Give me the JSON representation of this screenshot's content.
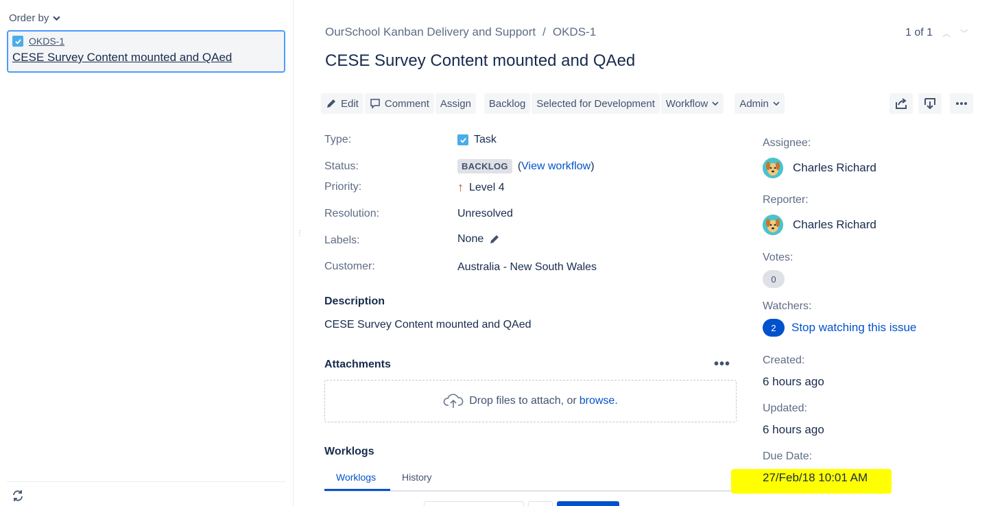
{
  "sidebar": {
    "order_by_label": "Order by",
    "issue": {
      "key": "OKDS-1",
      "summary": "CESE Survey Content mounted and QAed"
    }
  },
  "header": {
    "breadcrumb": {
      "project": "OurSchool Kanban Delivery and Support",
      "separator": "/",
      "key": "OKDS-1"
    },
    "pager": "1 of 1",
    "title": "CESE Survey Content mounted and QAed"
  },
  "toolbar": {
    "edit": "Edit",
    "comment": "Comment",
    "assign": "Assign",
    "backlog": "Backlog",
    "selected_for_development": "Selected for Development",
    "workflow": "Workflow",
    "admin": "Admin"
  },
  "details": {
    "type_label": "Type:",
    "type_value": "Task",
    "status_label": "Status:",
    "status_value": "BACKLOG",
    "view_workflow": "View workflow",
    "priority_label": "Priority:",
    "priority_value": "Level 4",
    "resolution_label": "Resolution:",
    "resolution_value": "Unresolved",
    "labels_label": "Labels:",
    "labels_value": "None",
    "customer_label": "Customer:",
    "customer_value": "Australia - New South Wales"
  },
  "description": {
    "heading": "Description",
    "text": "CESE Survey Content mounted and QAed"
  },
  "attachments": {
    "heading": "Attachments",
    "drop_text": "Drop files to attach, or",
    "browse": "browse."
  },
  "worklogs": {
    "heading": "Worklogs",
    "tabs": [
      "Worklogs",
      "History"
    ]
  },
  "people": {
    "assignee_label": "Assignee:",
    "assignee": "Charles Richard",
    "reporter_label": "Reporter:",
    "reporter": "Charles Richard",
    "votes_label": "Votes:",
    "votes": "0",
    "watchers_label": "Watchers:",
    "watchers": "2",
    "stop_watching": "Stop watching this issue"
  },
  "dates": {
    "created_label": "Created:",
    "created": "6 hours ago",
    "updated_label": "Updated:",
    "updated": "6 hours ago",
    "due_label": "Due Date:",
    "due": "27/Feb/18 10:01 AM"
  },
  "colors": {
    "accent": "#0052cc",
    "task_icon": "#4bade8",
    "highlight": "#ffff00",
    "priority": "#d04437"
  },
  "icons": [
    "chevron-down-icon",
    "task-icon",
    "refresh-icon",
    "pencil-icon",
    "comment-icon",
    "share-icon",
    "export-icon",
    "more-icon",
    "cloud-upload-icon",
    "avatar-icon",
    "priority-arrow-icon"
  ]
}
